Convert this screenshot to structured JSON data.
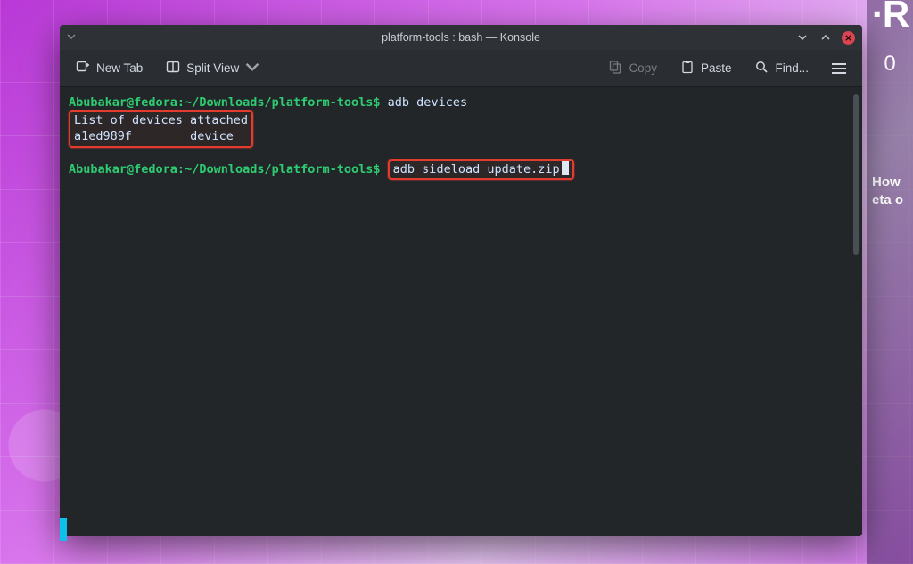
{
  "window": {
    "title": "platform-tools : bash — Konsole"
  },
  "toolbar": {
    "new_tab": "New Tab",
    "split_view": "Split View",
    "copy": "Copy",
    "paste": "Paste",
    "find": "Find..."
  },
  "terminal": {
    "prompt_user_host": "Abubakar@fedora",
    "prompt_separator": ":",
    "prompt_path": "~/Downloads/platform-tools",
    "prompt_symbol": "$",
    "cmd1": "adb devices",
    "out_header": "List of devices attached",
    "out_device_id": "a1ed989f",
    "out_device_status": "device",
    "cmd2": "adb sideload update.zip"
  },
  "right_panel": {
    "logo": "·R",
    "counter": "0",
    "line1": "How",
    "line2": "eta o"
  }
}
